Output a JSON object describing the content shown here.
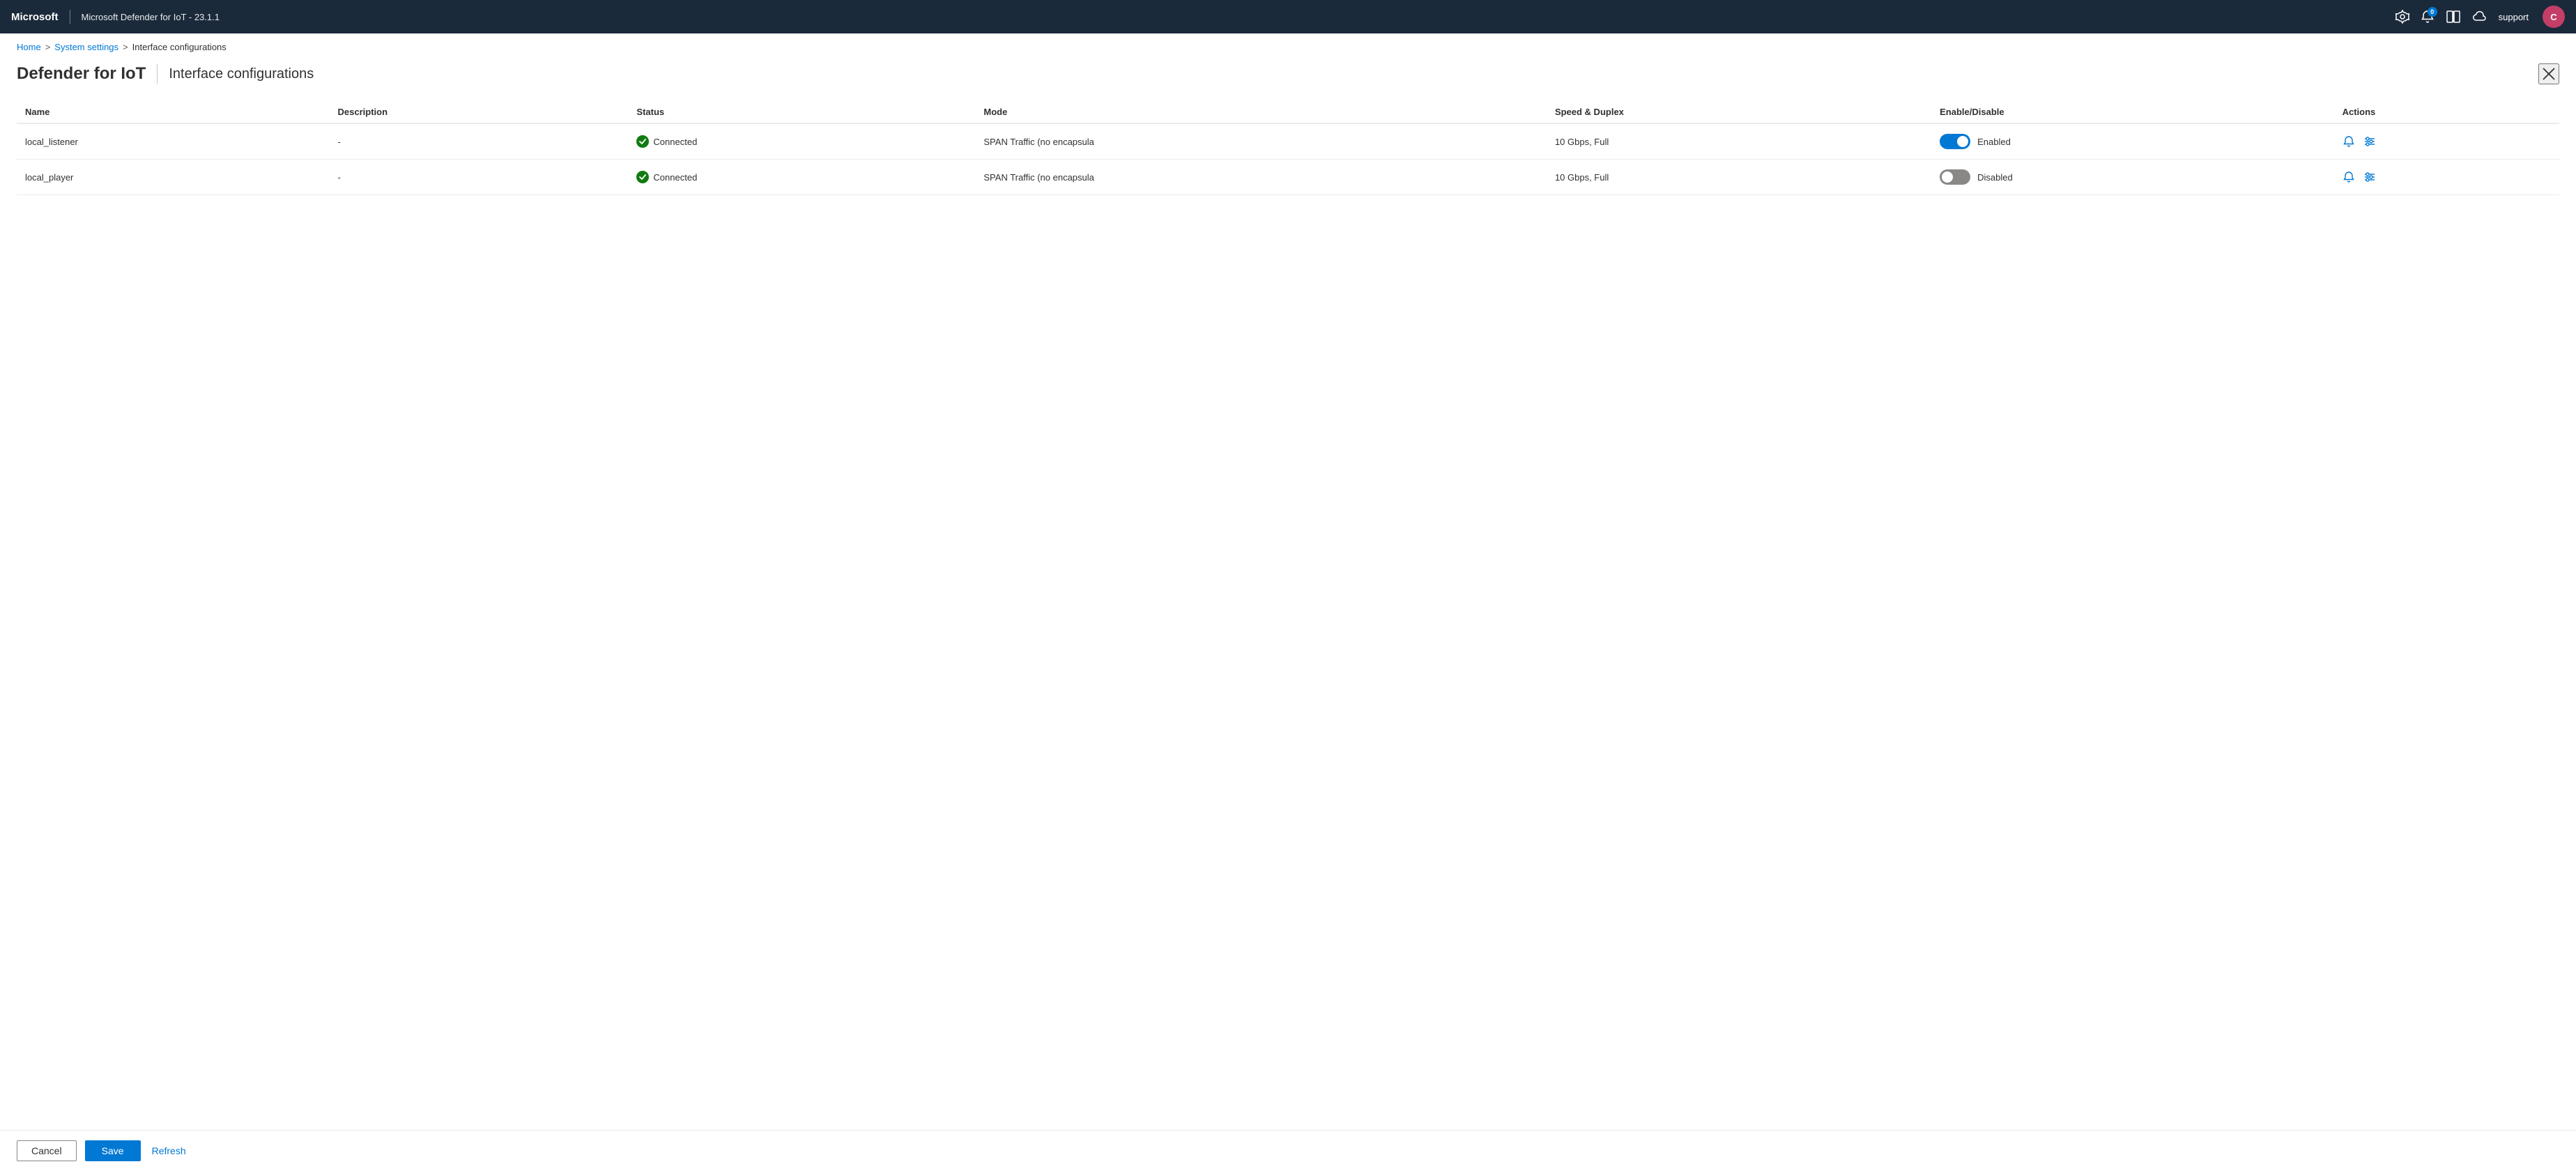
{
  "app": {
    "brand": "Microsoft",
    "title": "Microsoft Defender for IoT - 23.1.1"
  },
  "topbar": {
    "notifications_count": "0",
    "user_label": "support",
    "user_initials": "C",
    "settings_icon": "⚙",
    "notification_icon": "🔔",
    "book_icon": "📖",
    "cloud_icon": "☁"
  },
  "breadcrumb": {
    "home": "Home",
    "system_settings": "System settings",
    "current": "Interface configurations"
  },
  "page_header": {
    "brand": "Defender for IoT",
    "subtitle": "Interface configurations"
  },
  "table": {
    "columns": [
      "Name",
      "Description",
      "Status",
      "Mode",
      "Speed & Duplex",
      "Enable/Disable",
      "Actions"
    ],
    "rows": [
      {
        "name": "local_listener",
        "description": "-",
        "status": "Connected",
        "mode": "SPAN Traffic (no encapsula",
        "speed_duplex": "10 Gbps, Full",
        "enabled": true,
        "enable_label": "Enabled"
      },
      {
        "name": "local_player",
        "description": "-",
        "status": "Connected",
        "mode": "SPAN Traffic (no encapsula",
        "speed_duplex": "10 Gbps, Full",
        "enabled": false,
        "enable_label": "Disabled"
      }
    ]
  },
  "footer": {
    "cancel_label": "Cancel",
    "save_label": "Save",
    "refresh_label": "Refresh"
  }
}
